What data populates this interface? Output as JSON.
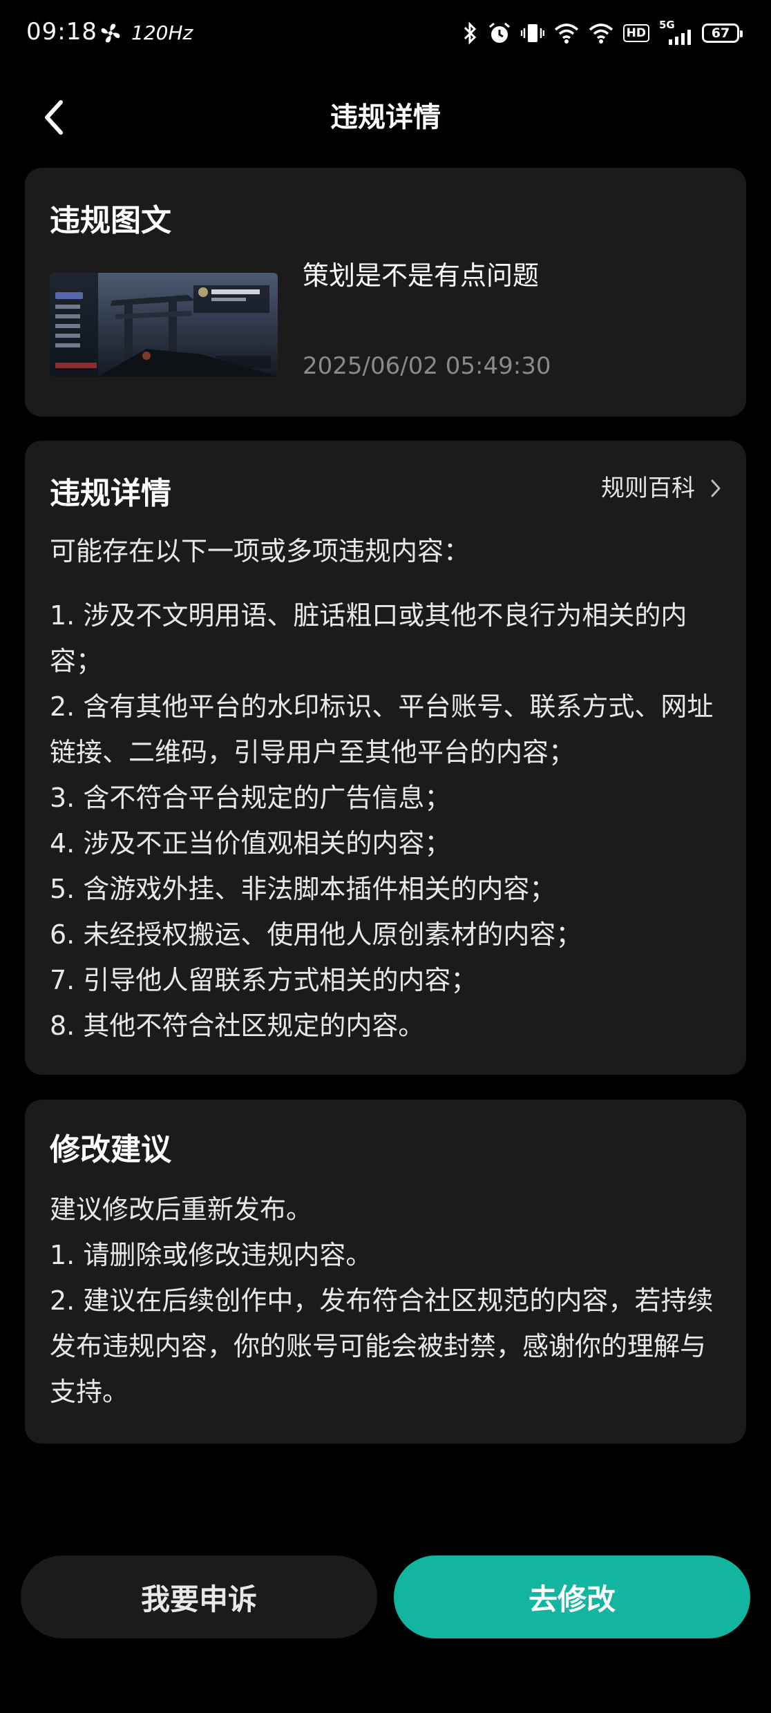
{
  "status_bar": {
    "time": "09:18",
    "refresh_rate": "120Hz",
    "network": "5G",
    "hd": "HD",
    "battery": "67"
  },
  "header": {
    "title": "违规详情",
    "back_icon": "chevron-left-icon"
  },
  "post_card": {
    "title": "违规图文",
    "post_title": "策划是不是有点问题",
    "timestamp": "2025/06/02 05:49:30"
  },
  "detail_card": {
    "title": "违规详情",
    "rules_link": "规则百科",
    "intro": "可能存在以下一项或多项违规内容：",
    "items": [
      "1. 涉及不文明用语、脏话粗口或其他不良行为相关的内容；",
      "2. 含有其他平台的水印标识、平台账号、联系方式、网址链接、二维码，引导用户至其他平台的内容；",
      "3. 含不符合平台规定的广告信息；",
      "4. 涉及不正当价值观相关的内容；",
      "5. 含游戏外挂、非法脚本插件相关的内容；",
      "6. 未经授权搬运、使用他人原创素材的内容；",
      "7. 引导他人留联系方式相关的内容；",
      "8. 其他不符合社区规定的内容。"
    ]
  },
  "suggest_card": {
    "title": "修改建议",
    "lines": [
      "建议修改后重新发布。",
      "1. 请删除或修改违规内容。",
      "2. 建议在后续创作中，发布符合社区规范的内容，若持续发布违规内容，你的账号可能会被封禁，感谢你的理解与支持。"
    ]
  },
  "buttons": {
    "appeal": "我要申诉",
    "edit": "去修改"
  },
  "colors": {
    "background": "#000000",
    "card": "#1b1b1b",
    "accent": "#12b5a0",
    "muted": "#8a8a8a"
  }
}
